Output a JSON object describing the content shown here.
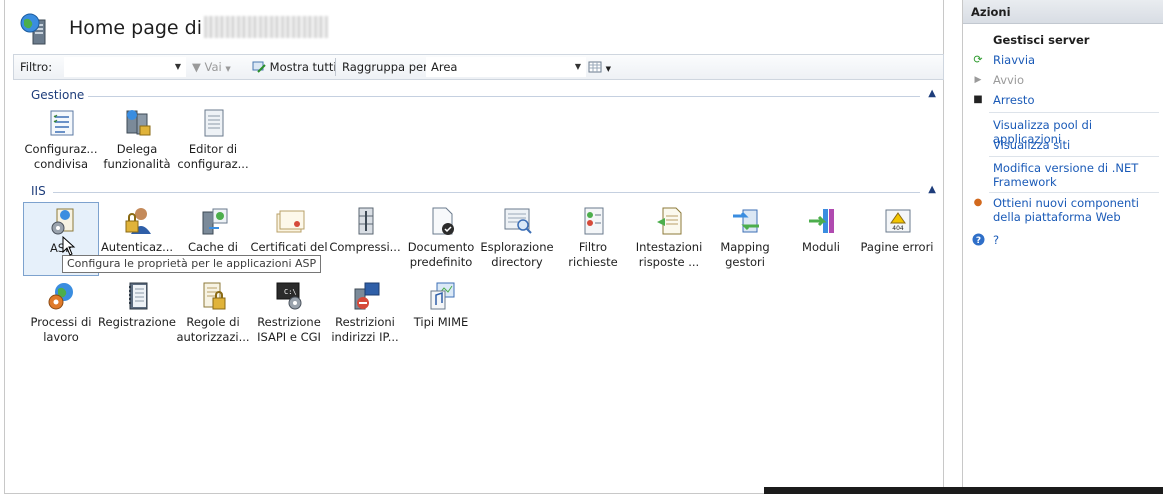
{
  "header": {
    "title": "Home page di"
  },
  "filterbar": {
    "filter_label": "Filtro:",
    "filter_value": "",
    "go_label": "Vai",
    "show_all_label": "Mostra tutti",
    "groupby_label": "Raggruppa per:",
    "groupby_value": "Area"
  },
  "groups": {
    "gestione": {
      "name": "Gestione",
      "items": [
        "Configuraz...\ncondivisa",
        "Delega\nfunzionalità",
        "Editor di\nconfiguraz..."
      ]
    },
    "iis": {
      "name": "IIS",
      "items": [
        "ASP",
        "Autenticaz...",
        "Cache di",
        "Certificati del",
        "Compressi...",
        "Documento\npredefinito",
        "Esplorazione\ndirectory",
        "Filtro\nrichieste",
        "Intestazioni\nrisposte ...",
        "Mapping\ngestori",
        "Moduli",
        "Pagine errori",
        "Processi di\nlavoro",
        "Registrazione",
        "Regole di\nautorizzazi...",
        "Restrizione\nISAPI e CGI",
        "Restrizioni\nindirizzi IP...",
        "Tipi MIME"
      ]
    }
  },
  "tooltip": "Configura le proprietà per le applicazioni ASP",
  "actions": {
    "title": "Azioni",
    "section": "Gestisci server",
    "restart": "Riavvia",
    "start": "Avvio",
    "stop": "Arresto",
    "view_pools": "Visualizza pool di applicazioni",
    "view_sites": "Visualizza siti",
    "change_net": "Modifica versione di .NET Framework",
    "get_components": "Ottieni nuovi componenti della piattaforma Web",
    "help": "?"
  },
  "colors": {
    "link": "#1a5ab7",
    "group_header": "#1e3d7b",
    "selection": "#e6f0fa"
  }
}
